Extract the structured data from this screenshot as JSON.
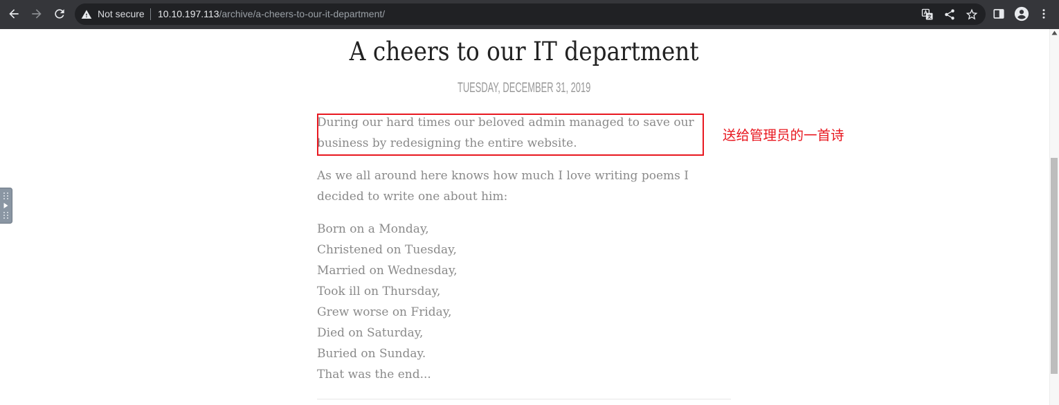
{
  "browser": {
    "icons": {
      "back": "arrow-left-icon",
      "forward": "arrow-right-icon",
      "reload": "reload-icon",
      "security": "warning-triangle-icon",
      "translate": "translate-icon",
      "share": "share-icon",
      "bookmark": "star-icon",
      "side_panel": "side-panel-icon",
      "profile": "profile-icon",
      "menu": "more-vertical-icon"
    },
    "security_label": "Not secure",
    "url": {
      "host": "10.10.197.113",
      "path": "/archive/a-cheers-to-our-it-department/"
    }
  },
  "post": {
    "title": "A cheers to our IT department",
    "date": "TUESDAY, DECEMBER 31, 2019",
    "paragraphs": [
      [
        "During our hard times our beloved admin managed to save our",
        "business by redesigning the entire website."
      ],
      [
        "As we all around here knows how much I love writing poems I",
        "decided to write one about him:"
      ]
    ],
    "poem": [
      "Born on a Monday,",
      "Christened on Tuesday,",
      "Married on Wednesday,",
      "Took ill on Thursday,",
      "Grew worse on Friday,",
      "Died on Saturday,",
      "Buried on Sunday.",
      "That was the end..."
    ]
  },
  "annotation": {
    "label": "送给管理员的一首诗"
  },
  "colors": {
    "toolbar": "#35363a",
    "omnibox": "#202124",
    "title": "#222222",
    "date": "#999999",
    "body_text": "#8a8a8a",
    "annotation": "#e8171f"
  }
}
